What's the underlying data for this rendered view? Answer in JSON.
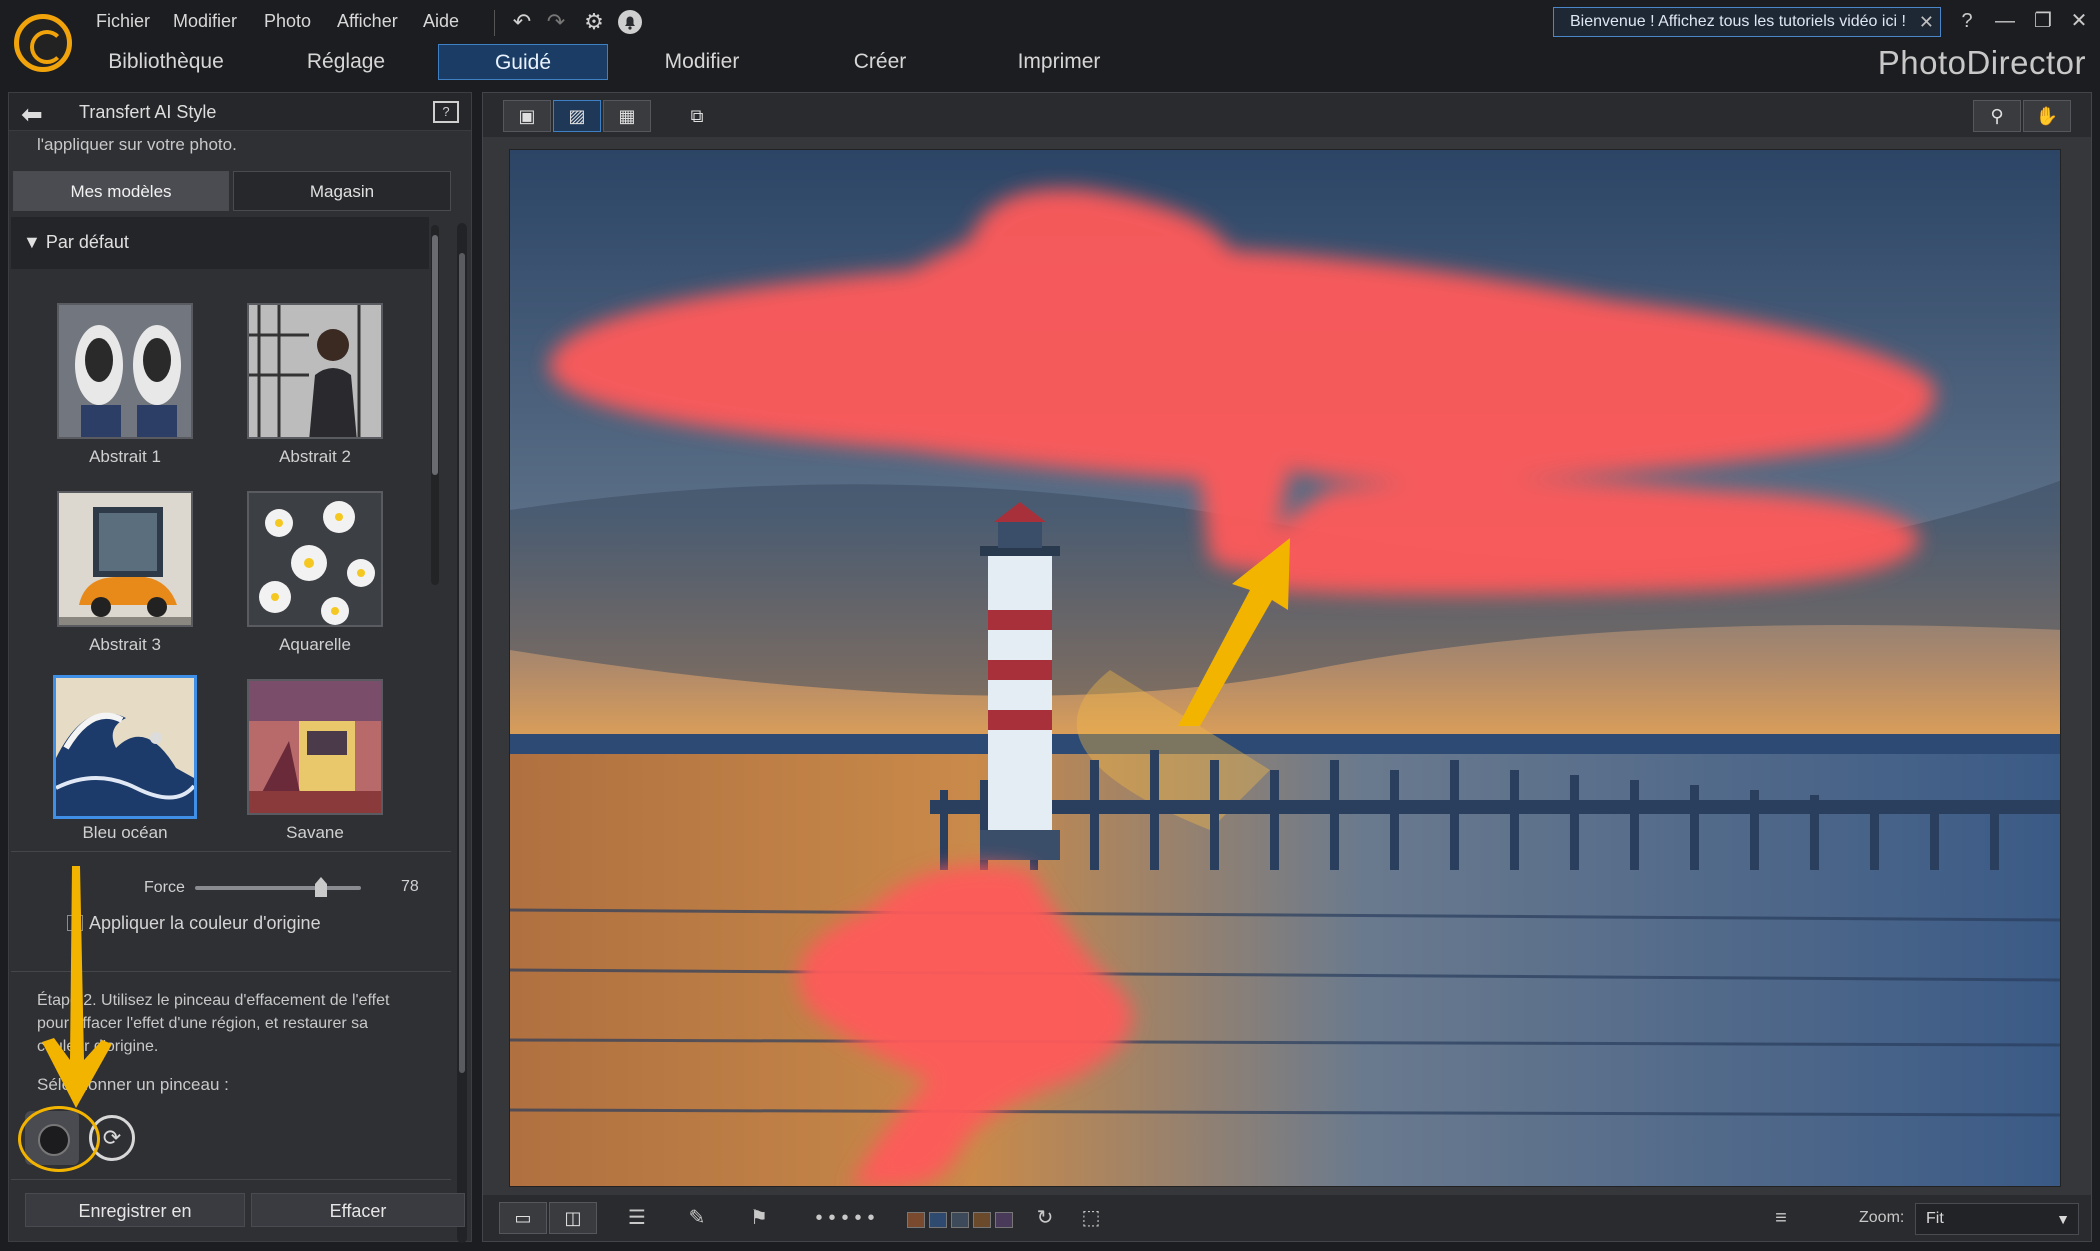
{
  "menu": {
    "items": [
      "Fichier",
      "Modifier",
      "Photo",
      "Afficher",
      "Aide"
    ]
  },
  "nav": {
    "tabs": [
      {
        "label": "Bibliothèque"
      },
      {
        "label": "Réglage"
      },
      {
        "label": "Guidé",
        "active": true
      },
      {
        "label": "Modifier"
      },
      {
        "label": "Créer"
      },
      {
        "label": "Imprimer"
      }
    ]
  },
  "welcome": {
    "text": "Bienvenue ! Affichez tous les tutoriels vidéo ici !"
  },
  "window_controls": {
    "help": "?",
    "minimize": "—",
    "restore": "❐",
    "close": "✕"
  },
  "brand": "PhotoDirector",
  "panel": {
    "title": "Transfert AI Style",
    "intro": "l'appliquer sur votre photo.",
    "tabs": {
      "models": "Mes modèles",
      "store": "Magasin"
    },
    "group": "Par défaut",
    "templates": [
      {
        "label": "Abstrait 1",
        "icon": "sneakers-thumbnail"
      },
      {
        "label": "Abstrait 2",
        "icon": "bookstore-man-thumbnail"
      },
      {
        "label": "Abstrait 3",
        "icon": "orange-car-thumbnail"
      },
      {
        "label": "Aquarelle",
        "icon": "white-flowers-thumbnail"
      },
      {
        "label": "Bleu océan",
        "icon": "great-wave-thumbnail",
        "selected": true
      },
      {
        "label": "Savane",
        "icon": "tram-painting-thumbnail"
      }
    ],
    "force": {
      "label": "Force",
      "value": "78",
      "level": 0.78
    },
    "original_color": {
      "label": "Appliquer la couleur d'origine",
      "checked": false
    },
    "step2": "Étape 2. Utilisez le pinceau d'effacement de l'effet pour effacer l'effet d'une région, et restaurer sa couleur d'origine.",
    "brush_label": "Sélectionner un pinceau :",
    "buttons": {
      "save": "Enregistrer en",
      "clear": "Effacer"
    }
  },
  "viewer": {
    "zoom_label": "Zoom:",
    "zoom_value": "Fit",
    "swatches": [
      "#7a4a2e",
      "#2e4a6e",
      "#3c4a5a",
      "#6a4a2a",
      "#4a3a5a"
    ]
  },
  "colors": {
    "accent": "#3f8fe6",
    "logo": "#f0a30a",
    "brush_mask": "#ff5a5a",
    "annotation": "#f3b400"
  }
}
